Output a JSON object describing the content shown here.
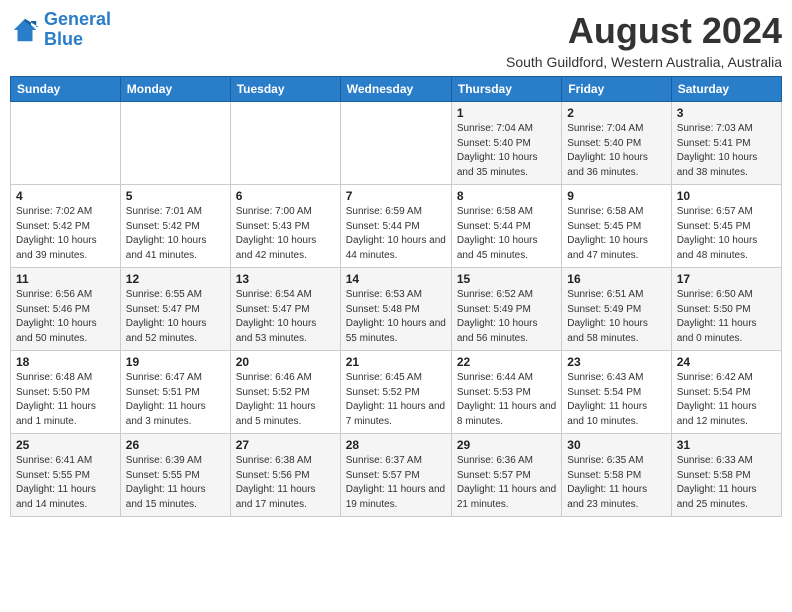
{
  "logo": {
    "line1": "General",
    "line2": "Blue"
  },
  "title": "August 2024",
  "subtitle": "South Guildford, Western Australia, Australia",
  "days_of_week": [
    "Sunday",
    "Monday",
    "Tuesday",
    "Wednesday",
    "Thursday",
    "Friday",
    "Saturday"
  ],
  "weeks": [
    [
      {
        "day": "",
        "info": ""
      },
      {
        "day": "",
        "info": ""
      },
      {
        "day": "",
        "info": ""
      },
      {
        "day": "",
        "info": ""
      },
      {
        "day": "1",
        "info": "Sunrise: 7:04 AM\nSunset: 5:40 PM\nDaylight: 10 hours\nand 35 minutes."
      },
      {
        "day": "2",
        "info": "Sunrise: 7:04 AM\nSunset: 5:40 PM\nDaylight: 10 hours\nand 36 minutes."
      },
      {
        "day": "3",
        "info": "Sunrise: 7:03 AM\nSunset: 5:41 PM\nDaylight: 10 hours\nand 38 minutes."
      }
    ],
    [
      {
        "day": "4",
        "info": "Sunrise: 7:02 AM\nSunset: 5:42 PM\nDaylight: 10 hours\nand 39 minutes."
      },
      {
        "day": "5",
        "info": "Sunrise: 7:01 AM\nSunset: 5:42 PM\nDaylight: 10 hours\nand 41 minutes."
      },
      {
        "day": "6",
        "info": "Sunrise: 7:00 AM\nSunset: 5:43 PM\nDaylight: 10 hours\nand 42 minutes."
      },
      {
        "day": "7",
        "info": "Sunrise: 6:59 AM\nSunset: 5:44 PM\nDaylight: 10 hours\nand 44 minutes."
      },
      {
        "day": "8",
        "info": "Sunrise: 6:58 AM\nSunset: 5:44 PM\nDaylight: 10 hours\nand 45 minutes."
      },
      {
        "day": "9",
        "info": "Sunrise: 6:58 AM\nSunset: 5:45 PM\nDaylight: 10 hours\nand 47 minutes."
      },
      {
        "day": "10",
        "info": "Sunrise: 6:57 AM\nSunset: 5:45 PM\nDaylight: 10 hours\nand 48 minutes."
      }
    ],
    [
      {
        "day": "11",
        "info": "Sunrise: 6:56 AM\nSunset: 5:46 PM\nDaylight: 10 hours\nand 50 minutes."
      },
      {
        "day": "12",
        "info": "Sunrise: 6:55 AM\nSunset: 5:47 PM\nDaylight: 10 hours\nand 52 minutes."
      },
      {
        "day": "13",
        "info": "Sunrise: 6:54 AM\nSunset: 5:47 PM\nDaylight: 10 hours\nand 53 minutes."
      },
      {
        "day": "14",
        "info": "Sunrise: 6:53 AM\nSunset: 5:48 PM\nDaylight: 10 hours\nand 55 minutes."
      },
      {
        "day": "15",
        "info": "Sunrise: 6:52 AM\nSunset: 5:49 PM\nDaylight: 10 hours\nand 56 minutes."
      },
      {
        "day": "16",
        "info": "Sunrise: 6:51 AM\nSunset: 5:49 PM\nDaylight: 10 hours\nand 58 minutes."
      },
      {
        "day": "17",
        "info": "Sunrise: 6:50 AM\nSunset: 5:50 PM\nDaylight: 11 hours\nand 0 minutes."
      }
    ],
    [
      {
        "day": "18",
        "info": "Sunrise: 6:48 AM\nSunset: 5:50 PM\nDaylight: 11 hours\nand 1 minute."
      },
      {
        "day": "19",
        "info": "Sunrise: 6:47 AM\nSunset: 5:51 PM\nDaylight: 11 hours\nand 3 minutes."
      },
      {
        "day": "20",
        "info": "Sunrise: 6:46 AM\nSunset: 5:52 PM\nDaylight: 11 hours\nand 5 minutes."
      },
      {
        "day": "21",
        "info": "Sunrise: 6:45 AM\nSunset: 5:52 PM\nDaylight: 11 hours\nand 7 minutes."
      },
      {
        "day": "22",
        "info": "Sunrise: 6:44 AM\nSunset: 5:53 PM\nDaylight: 11 hours\nand 8 minutes."
      },
      {
        "day": "23",
        "info": "Sunrise: 6:43 AM\nSunset: 5:54 PM\nDaylight: 11 hours\nand 10 minutes."
      },
      {
        "day": "24",
        "info": "Sunrise: 6:42 AM\nSunset: 5:54 PM\nDaylight: 11 hours\nand 12 minutes."
      }
    ],
    [
      {
        "day": "25",
        "info": "Sunrise: 6:41 AM\nSunset: 5:55 PM\nDaylight: 11 hours\nand 14 minutes."
      },
      {
        "day": "26",
        "info": "Sunrise: 6:39 AM\nSunset: 5:55 PM\nDaylight: 11 hours\nand 15 minutes."
      },
      {
        "day": "27",
        "info": "Sunrise: 6:38 AM\nSunset: 5:56 PM\nDaylight: 11 hours\nand 17 minutes."
      },
      {
        "day": "28",
        "info": "Sunrise: 6:37 AM\nSunset: 5:57 PM\nDaylight: 11 hours\nand 19 minutes."
      },
      {
        "day": "29",
        "info": "Sunrise: 6:36 AM\nSunset: 5:57 PM\nDaylight: 11 hours\nand 21 minutes."
      },
      {
        "day": "30",
        "info": "Sunrise: 6:35 AM\nSunset: 5:58 PM\nDaylight: 11 hours\nand 23 minutes."
      },
      {
        "day": "31",
        "info": "Sunrise: 6:33 AM\nSunset: 5:58 PM\nDaylight: 11 hours\nand 25 minutes."
      }
    ]
  ]
}
